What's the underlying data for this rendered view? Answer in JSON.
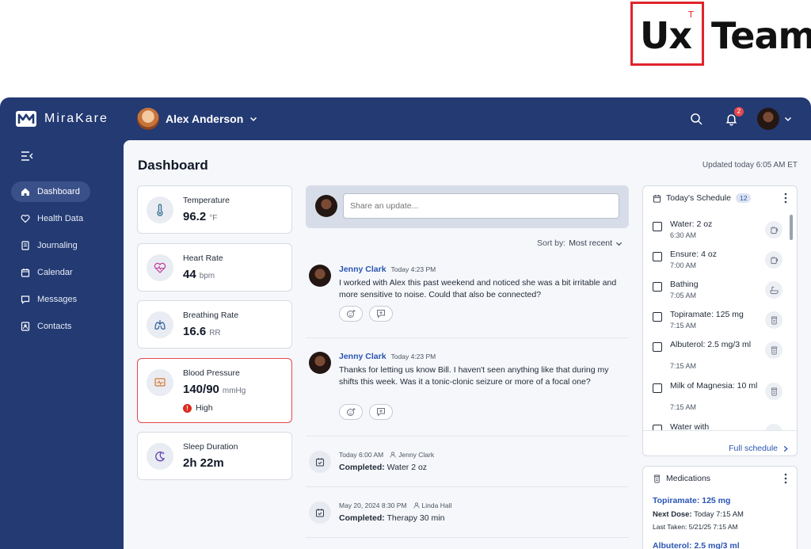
{
  "brand_logo": {
    "ux": "Ux",
    "sup": "T",
    "team": "Team"
  },
  "app": {
    "name": "MiraKare"
  },
  "header": {
    "patient_name": "Alex Anderson",
    "notification_count": "2"
  },
  "sidebar": {
    "items": [
      {
        "label": "Dashboard",
        "icon": "home-icon",
        "active": true
      },
      {
        "label": "Health Data",
        "icon": "heart-icon"
      },
      {
        "label": "Journaling",
        "icon": "journal-icon"
      },
      {
        "label": "Calendar",
        "icon": "calendar-icon"
      },
      {
        "label": "Messages",
        "icon": "message-icon"
      },
      {
        "label": "Contacts",
        "icon": "contacts-icon"
      }
    ]
  },
  "main": {
    "title": "Dashboard",
    "updated": "Updated today 6:05 AM ET"
  },
  "vitals": [
    {
      "label": "Temperature",
      "value": "96.2",
      "unit": "°F",
      "icon": "thermometer-icon"
    },
    {
      "label": "Heart Rate",
      "value": "44",
      "unit": "bpm",
      "icon": "heart-rate-icon"
    },
    {
      "label": "Breathing Rate",
      "value": "16.6",
      "unit": "RR",
      "icon": "lungs-icon"
    },
    {
      "label": "Blood Pressure",
      "value": "140/90",
      "unit": "mmHg",
      "icon": "monitor-icon",
      "status": "High"
    },
    {
      "label": "Sleep Duration",
      "value": "2h 22m",
      "unit": "",
      "icon": "moon-icon"
    }
  ],
  "feed": {
    "share_placeholder": "Share an update...",
    "sort_label": "Sort by:",
    "sort_value": "Most recent",
    "posts": [
      {
        "author": "Jenny Clark",
        "time": "Today 4:23 PM",
        "text": "I worked with Alex this past weekend and noticed she was a bit irritable and more sensitive to noise. Could that also be connected?"
      },
      {
        "author": "Jenny Clark",
        "time": "Today 4:23 PM",
        "text": "Thanks for letting us know Bill. I haven't seen anything like that during my shifts this week. Was it a tonic-clonic seizure or more of a focal one?"
      }
    ],
    "activities": [
      {
        "time": "Today 6:00 AM",
        "user": "Jenny Clark",
        "prefix": "Completed:",
        "task": "Water 2 oz"
      },
      {
        "time": "May 20, 2024 8:30 PM",
        "user": "Linda Hall",
        "prefix": "Completed:",
        "task": "Therapy 30 min"
      }
    ]
  },
  "schedule": {
    "title": "Today's Schedule",
    "count": "12",
    "items": [
      {
        "name": "Water: 2 oz",
        "time": "6:30 AM",
        "icon": "cup-icon"
      },
      {
        "name": "Ensure: 4 oz",
        "time": "7:00 AM",
        "icon": "cup-icon"
      },
      {
        "name": "Bathing",
        "time": "7:05 AM",
        "icon": "bath-icon"
      },
      {
        "name": "Topiramate: 125 mg",
        "time": "7:15 AM",
        "icon": "pill-bottle-icon"
      },
      {
        "name": "Albuterol: 2.5 mg/3 ml",
        "time": "7:15 AM",
        "icon": "pill-bottle-icon"
      },
      {
        "name": "Milk of Magnesia: 10 ml",
        "time": "7:15 AM",
        "icon": "pill-bottle-icon"
      },
      {
        "name": "Water with",
        "time": "",
        "icon": "cup-icon"
      }
    ],
    "full_link": "Full schedule"
  },
  "medications": {
    "title": "Medications",
    "items": [
      {
        "name": "Topiramate: 125 mg",
        "next_label": "Next Dose:",
        "next_value": "Today 7:15 AM",
        "last": "Last Taken: 5/21/25 7:15 AM"
      },
      {
        "name": "Albuterol: 2.5 mg/3 ml"
      }
    ]
  }
}
